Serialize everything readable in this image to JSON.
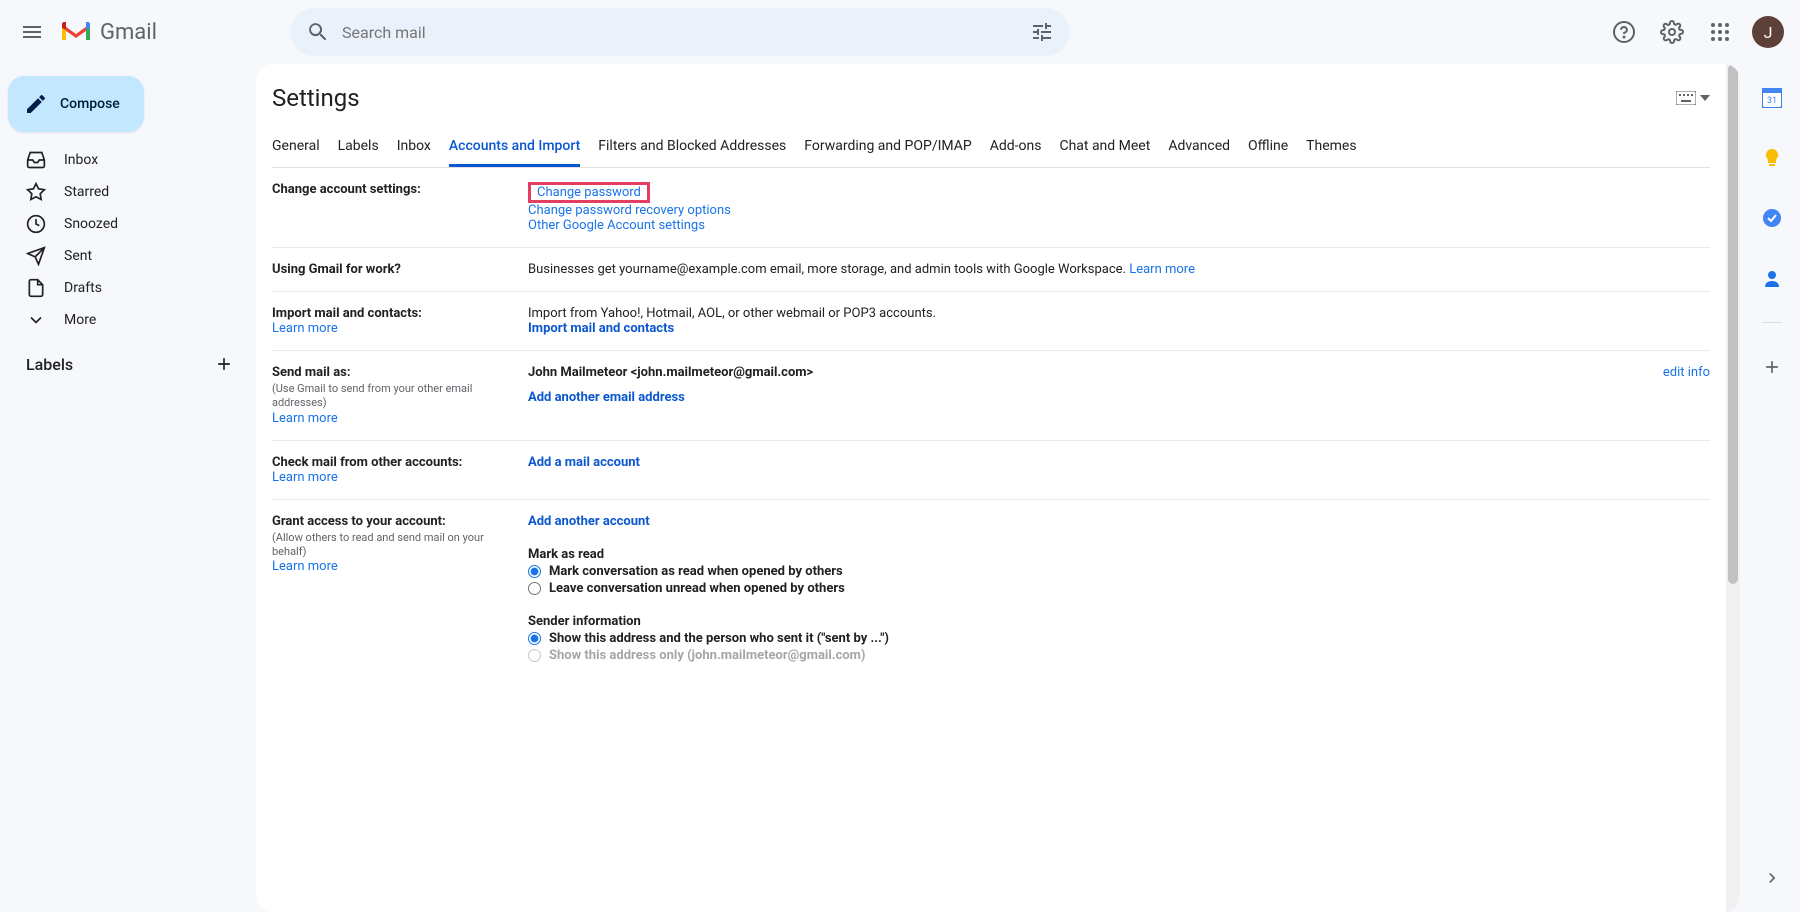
{
  "header": {
    "search_placeholder": "Search mail",
    "avatar_initial": "J"
  },
  "sidebar": {
    "compose_label": "Compose",
    "items": [
      {
        "label": "Inbox"
      },
      {
        "label": "Starred"
      },
      {
        "label": "Snoozed"
      },
      {
        "label": "Sent"
      },
      {
        "label": "Drafts"
      },
      {
        "label": "More"
      }
    ],
    "labels_header": "Labels"
  },
  "settings": {
    "title": "Settings",
    "tabs": [
      "General",
      "Labels",
      "Inbox",
      "Accounts and Import",
      "Filters and Blocked Addresses",
      "Forwarding and POP/IMAP",
      "Add-ons",
      "Chat and Meet",
      "Advanced",
      "Offline",
      "Themes"
    ],
    "active_tab": "Accounts and Import",
    "rows": {
      "change_account": {
        "label": "Change account settings:",
        "links": {
          "change_password": "Change password",
          "recovery": "Change password recovery options",
          "other": "Other Google Account settings"
        }
      },
      "using_work": {
        "label": "Using Gmail for work?",
        "text": "Businesses get yourname@example.com email, more storage, and admin tools with Google Workspace. ",
        "learn_more": "Learn more"
      },
      "import_contacts": {
        "label": "Import mail and contacts:",
        "learn_more": "Learn more",
        "text": "Import from Yahoo!, Hotmail, AOL, or other webmail or POP3 accounts.",
        "link": "Import mail and contacts"
      },
      "send_mail_as": {
        "label": "Send mail as:",
        "sublabel": "(Use Gmail to send from your other email addresses)",
        "learn_more": "Learn more",
        "name_display": "John Mailmeteor <john.mailmeteor@gmail.com>",
        "edit_info": "edit info",
        "add_email": "Add another email address"
      },
      "check_mail": {
        "label": "Check mail from other accounts:",
        "learn_more": "Learn more",
        "link": "Add a mail account"
      },
      "grant_access": {
        "label": "Grant access to your account:",
        "sublabel": "(Allow others to read and send mail on your behalf)",
        "learn_more": "Learn more",
        "add_account": "Add another account",
        "mark_as_read_hd": "Mark as read",
        "radio_read": "Mark conversation as read when opened by others",
        "radio_unread": "Leave conversation unread when opened by others",
        "sender_info_hd": "Sender information",
        "radio_show_both": "Show this address and the person who sent it (\"sent by ...\")",
        "radio_show_only": "Show this address only (john.mailmeteor@gmail.com)"
      }
    }
  }
}
